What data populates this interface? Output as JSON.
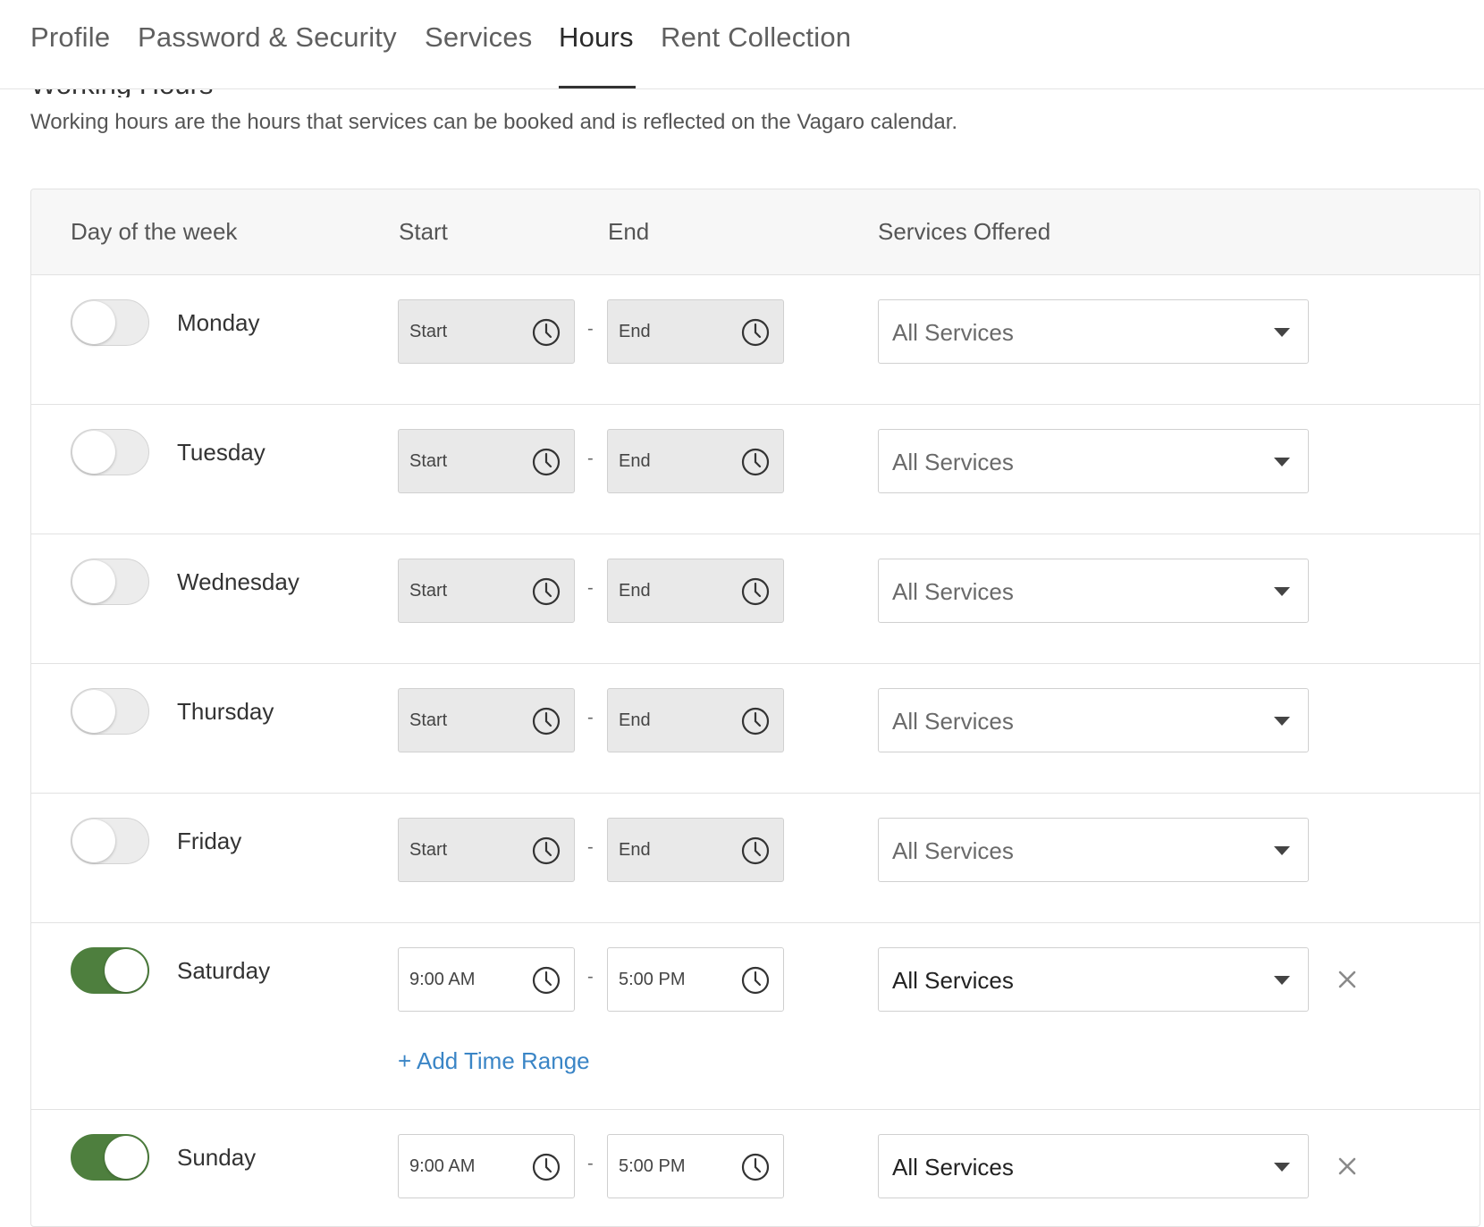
{
  "tabs": [
    {
      "label": "Profile"
    },
    {
      "label": "Password & Security"
    },
    {
      "label": "Services"
    },
    {
      "label": "Hours"
    },
    {
      "label": "Rent Collection"
    }
  ],
  "active_tab": "Hours",
  "section": {
    "title": "Working Hours",
    "description": "Working hours are the hours that services can be booked and is reflected on the Vagaro calendar."
  },
  "table": {
    "headers": {
      "day": "Day of the week",
      "start": "Start",
      "end": "End",
      "services": "Services Offered"
    },
    "separator": "-",
    "rows": [
      {
        "day": "Monday",
        "enabled": false,
        "start": "Start",
        "end": "End",
        "services": "All Services"
      },
      {
        "day": "Tuesday",
        "enabled": false,
        "start": "Start",
        "end": "End",
        "services": "All Services"
      },
      {
        "day": "Wednesday",
        "enabled": false,
        "start": "Start",
        "end": "End",
        "services": "All Services"
      },
      {
        "day": "Thursday",
        "enabled": false,
        "start": "Start",
        "end": "End",
        "services": "All Services"
      },
      {
        "day": "Friday",
        "enabled": false,
        "start": "Start",
        "end": "End",
        "services": "All Services"
      },
      {
        "day": "Saturday",
        "enabled": true,
        "start": "9:00 AM",
        "end": "5:00 PM",
        "services": "All Services"
      },
      {
        "day": "Sunday",
        "enabled": true,
        "start": "9:00 AM",
        "end": "5:00 PM",
        "services": "All Services"
      }
    ],
    "add_time_range": "+ Add Time Range"
  },
  "colors": {
    "toggle_on": "#4e7f3e",
    "link": "#3a85c6"
  }
}
